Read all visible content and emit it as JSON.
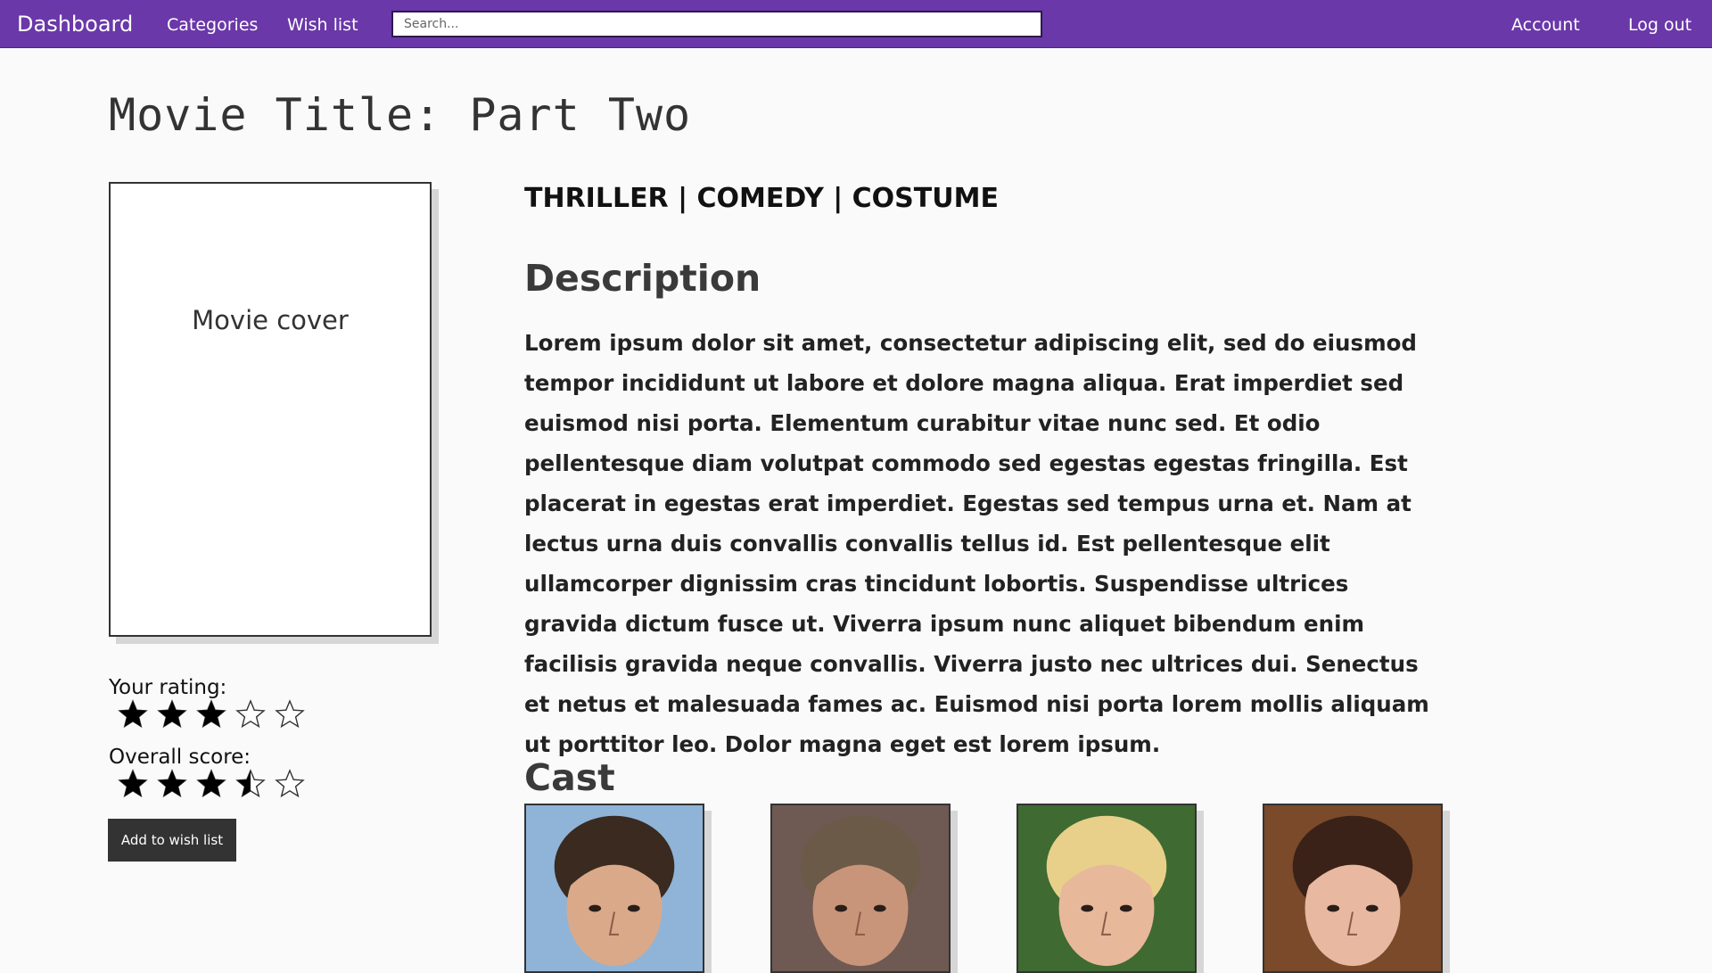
{
  "nav": {
    "brand": "Dashboard",
    "links": [
      "Categories",
      "Wish list"
    ],
    "search_placeholder": "Search...",
    "account": "Account",
    "logout": "Log out",
    "bar_color": "#6a38a8"
  },
  "movie": {
    "title": "Movie Title: Part Two",
    "cover_label": "Movie cover",
    "genres": "THRILLER | COMEDY | COSTUME",
    "description_heading": "Description",
    "description": "Lorem ipsum dolor sit amet, consectetur adipiscing elit, sed do eiusmod tempor incididunt ut labore et dolore magna aliqua. Erat imperdiet sed euismod nisi porta. Elementum curabitur vitae nunc sed. Et odio pellentesque diam volutpat commodo sed egestas egestas fringilla. Est placerat in egestas erat imperdiet. Egestas sed tempus urna et. Nam at lectus urna duis convallis convallis tellus id. Est pellentesque elit ullamcorper dignissim cras tincidunt lobortis. Suspendisse ultrices gravida dictum fusce ut. Viverra ipsum nunc aliquet bibendum enim facilisis gravida neque convallis. Viverra justo nec ultrices dui. Senectus et netus et malesuada fames ac. Euismod nisi porta lorem mollis aliquam ut porttitor leo. Dolor magna eget est lorem ipsum.",
    "cast_heading": "Cast"
  },
  "ratings": {
    "your_rating_label": "Your rating:",
    "your_rating": 3,
    "overall_label": "Overall score:",
    "overall_score": 3.5,
    "max_stars": 5
  },
  "actions": {
    "add_to_wishlist": "Add to wish list"
  },
  "cast": [
    {
      "name": "cast-member-1",
      "bg": "#8fb4d8",
      "skin": "#d9a98a",
      "hair": "#3a2a20"
    },
    {
      "name": "cast-member-2",
      "bg": "#6e5a52",
      "skin": "#c9957a",
      "hair": "#6b5a48"
    },
    {
      "name": "cast-member-3",
      "bg": "#3f6a32",
      "skin": "#e8b89a",
      "hair": "#e8d08a"
    },
    {
      "name": "cast-member-4",
      "bg": "#7a4a2a",
      "skin": "#e8b8a0",
      "hair": "#3a2218"
    }
  ]
}
